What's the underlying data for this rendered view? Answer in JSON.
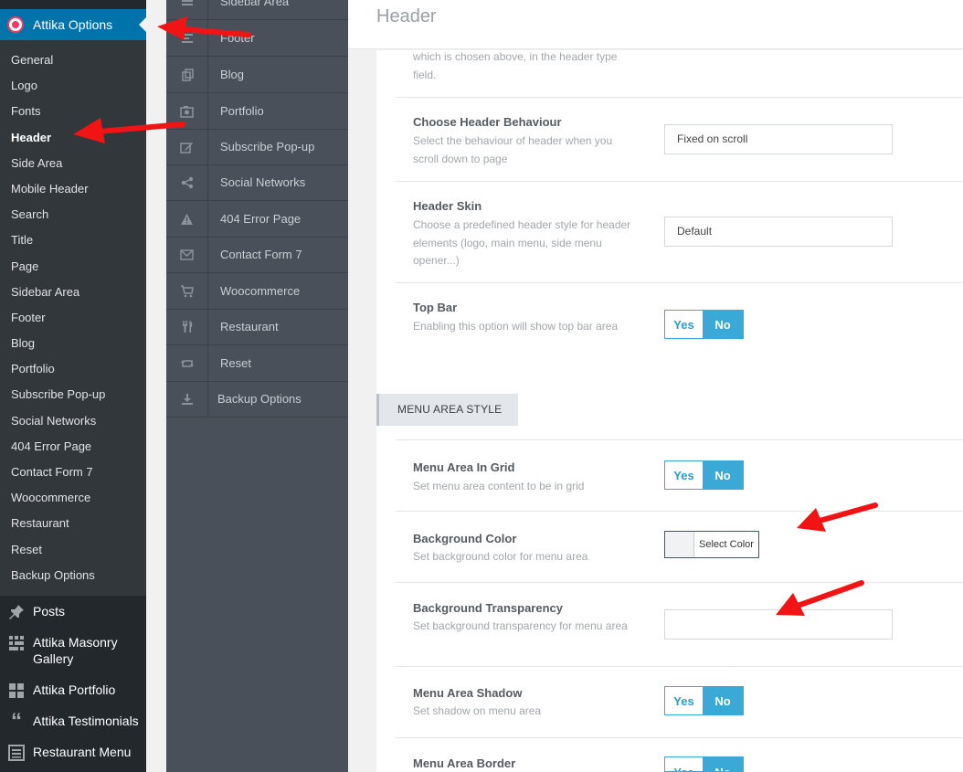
{
  "admin_menu": {
    "active_plugin": "Attika Options",
    "submenu": [
      "General",
      "Logo",
      "Fonts",
      "Header",
      "Side Area",
      "Mobile Header",
      "Search",
      "Title",
      "Page",
      "Sidebar Area",
      "Footer",
      "Blog",
      "Portfolio",
      "Subscribe Pop-up",
      "Social Networks",
      "404 Error Page",
      "Contact Form 7",
      "Woocommerce",
      "Restaurant",
      "Reset",
      "Backup Options"
    ],
    "current_submenu": "Header",
    "main_items": [
      {
        "label": "Posts",
        "icon": "pin-icon"
      },
      {
        "label": "Attika Masonry Gallery",
        "icon": "grid-icon"
      },
      {
        "label": "Attika Portfolio",
        "icon": "portfolio-grid-icon"
      },
      {
        "label": "Attika Testimonials",
        "icon": "quote-icon"
      },
      {
        "label": "Restaurant Menu",
        "icon": "list-icon"
      }
    ]
  },
  "options_nav": {
    "tabs": [
      {
        "label": "Sidebar Area",
        "icon": "sidebar-icon"
      },
      {
        "label": "Footer",
        "icon": "footer-icon"
      },
      {
        "label": "Blog",
        "icon": "blog-icon"
      },
      {
        "label": "Portfolio",
        "icon": "camera-icon"
      },
      {
        "label": "Subscribe Pop-up",
        "icon": "edit-icon"
      },
      {
        "label": "Social Networks",
        "icon": "share-icon"
      },
      {
        "label": "404 Error Page",
        "icon": "warning-icon"
      },
      {
        "label": "Contact Form 7",
        "icon": "envelope-icon"
      },
      {
        "label": "Woocommerce",
        "icon": "cart-icon"
      },
      {
        "label": "Restaurant",
        "icon": "cutlery-icon"
      },
      {
        "label": "Reset",
        "icon": "reset-icon"
      },
      {
        "label": "Backup Options",
        "icon": "download-icon"
      }
    ]
  },
  "content": {
    "page_title": "Header",
    "partial_desc": "which is chosen above, in the header type field.",
    "behaviour": {
      "title": "Choose Header Behaviour",
      "desc": "Select the behaviour of header when you scroll down to page",
      "value": "Fixed on scroll"
    },
    "skin": {
      "title": "Header Skin",
      "desc": "Choose a predefined header style for header elements (logo, main menu, side menu opener...)",
      "value": "Default"
    },
    "top_bar": {
      "title": "Top Bar",
      "desc": "Enabling this option will show top bar area",
      "yes": "Yes",
      "no": "No",
      "selected": "No"
    },
    "section_label": "MENU AREA STYLE",
    "menu_grid": {
      "title": "Menu Area In Grid",
      "desc": "Set menu area content to be in grid",
      "yes": "Yes",
      "no": "No",
      "selected": "No"
    },
    "bg_color": {
      "title": "Background Color",
      "desc": "Set background color for menu area",
      "button": "Select Color"
    },
    "bg_transparency": {
      "title": "Background Transparency",
      "desc": "Set background transparency for menu area",
      "value": ""
    },
    "shadow": {
      "title": "Menu Area Shadow",
      "desc": "Set shadow on menu area",
      "yes": "Yes",
      "no": "No",
      "selected": "No"
    },
    "border": {
      "title": "Menu Area Border",
      "yes": "Yes",
      "no": "No",
      "selected": "No"
    }
  },
  "colors": {
    "admin_bg": "#23282d",
    "submenu_bg": "#32373c",
    "active_blue": "#0073aa",
    "options_nav_bg": "#4a5059",
    "toggle_blue": "#3aa9d8",
    "annotation_red": "#f01414"
  }
}
